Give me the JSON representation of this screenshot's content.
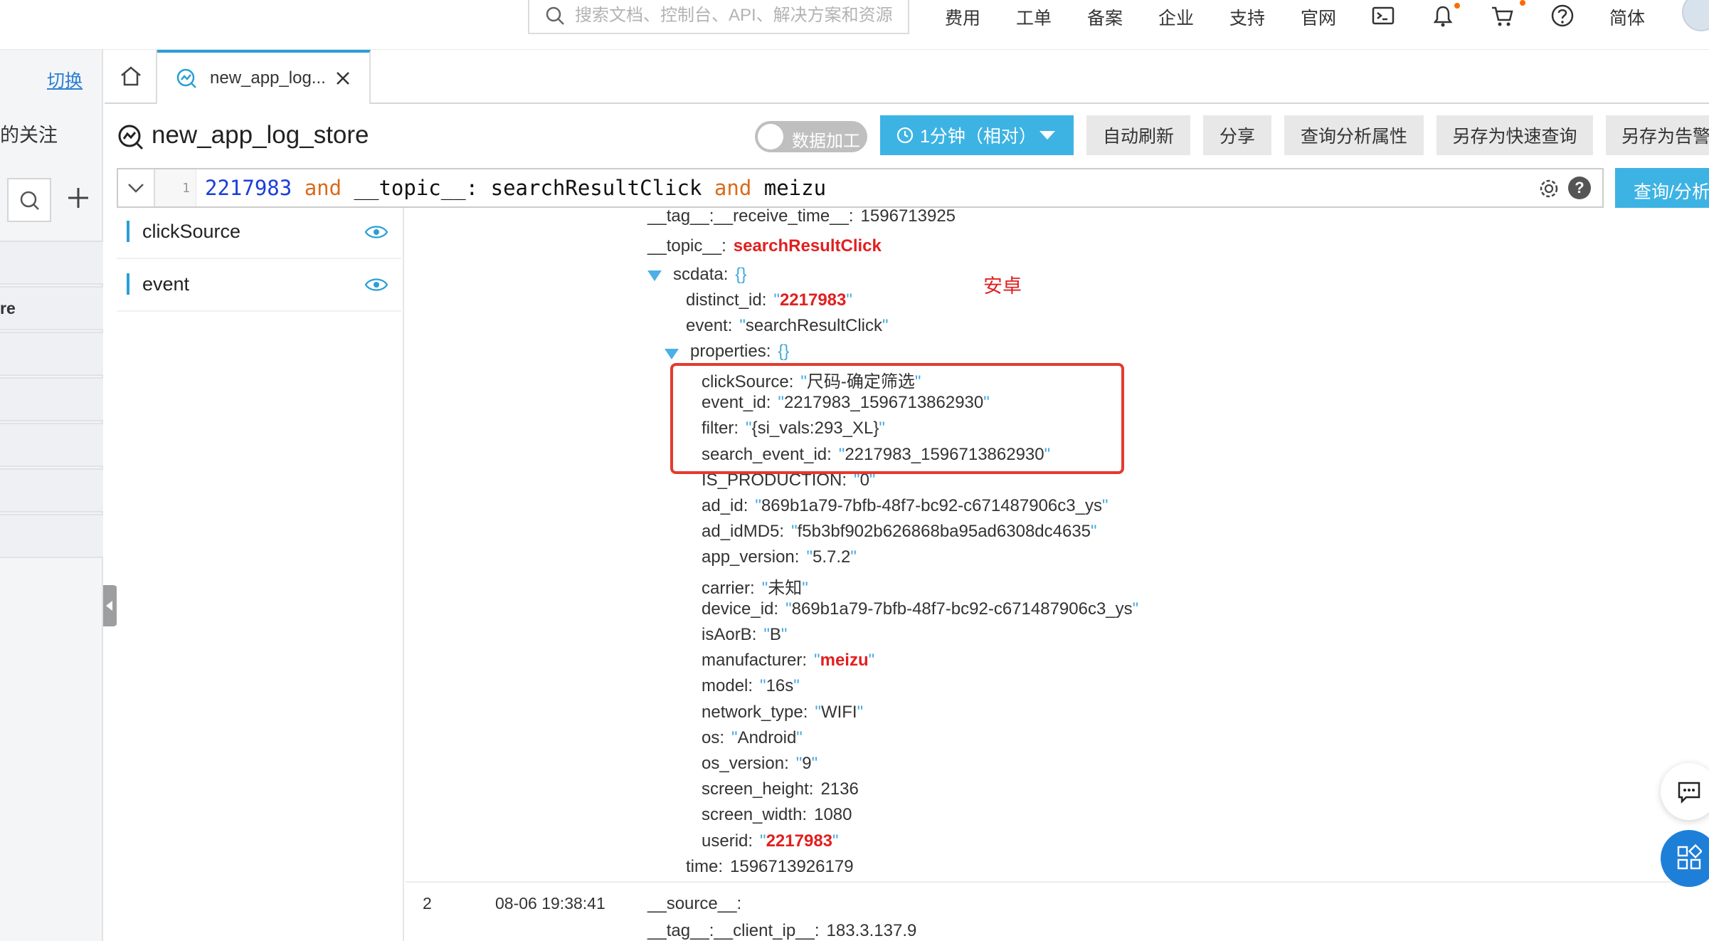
{
  "topbar": {
    "search_placeholder": "搜索文档、控制台、API、解决方案和资源",
    "nav": [
      "费用",
      "工单",
      "备案",
      "企业",
      "支持",
      "官网"
    ],
    "lang": "简体",
    "icons": [
      "terminal-icon",
      "bell-icon",
      "cart-icon",
      "help-icon"
    ],
    "accent": "#ff6a00"
  },
  "left_panel": {
    "switch_label": "切换",
    "fav_label": "的关注",
    "rows": [
      "",
      "re",
      "",
      "",
      "",
      "",
      ""
    ]
  },
  "tabs": {
    "home_icon": "home-icon",
    "active_tab": "new_app_log..."
  },
  "header": {
    "logstore_name": "new_app_log_store",
    "toggle_label": "数据加工",
    "time_range": "1分钟（相对）",
    "buttons": [
      "自动刷新",
      "分享",
      "查询分析属性",
      "另存为快速查询",
      "另存为告警"
    ],
    "accent": "#3db3e4"
  },
  "query": {
    "line_number": "1",
    "num": "2217983",
    "and1": "and",
    "field": "__topic__:",
    "value": "searchResultClick",
    "and2": "and",
    "value2": "meizu",
    "submit_label": "查询/分析"
  },
  "fields": [
    "clickSource",
    "event"
  ],
  "log": {
    "annotation": "安卓",
    "header_lines": {
      "receive_time_key": "__tag__:__receive_time__",
      "receive_time_val": "1596713925",
      "topic_key": "__topic__",
      "topic_val": "searchResultClick",
      "scdata_key": "scdata",
      "distinct_id_key": "distinct_id",
      "distinct_id_val": "2217983",
      "event_key": "event",
      "event_val": "searchResultClick",
      "properties_key": "properties"
    },
    "properties": [
      {
        "k": "clickSource",
        "v": "尺码-确定筛选",
        "red": false
      },
      {
        "k": "event_id",
        "v": "2217983_1596713862930",
        "red": false
      },
      {
        "k": "filter",
        "v": "{si_vals:293_XL}",
        "red": false
      },
      {
        "k": "search_event_id",
        "v": "2217983_1596713862930",
        "red": false
      },
      {
        "k": "IS_PRODUCTION",
        "v": "0",
        "red": false
      },
      {
        "k": "ad_id",
        "v": "869b1a79-7bfb-48f7-bc92-c671487906c3_ys",
        "red": false
      },
      {
        "k": "ad_idMD5",
        "v": "f5b3bf902b626868ba95ad6308dc4635",
        "red": false
      },
      {
        "k": "app_version",
        "v": "5.7.2",
        "red": false
      },
      {
        "k": "carrier",
        "v": "未知",
        "red": false
      },
      {
        "k": "device_id",
        "v": "869b1a79-7bfb-48f7-bc92-c671487906c3_ys",
        "red": false
      },
      {
        "k": "isAorB",
        "v": "B",
        "red": false
      },
      {
        "k": "manufacturer",
        "v": "meizu",
        "red": true
      },
      {
        "k": "model",
        "v": "16s",
        "red": false
      },
      {
        "k": "network_type",
        "v": "WIFI",
        "red": false
      },
      {
        "k": "os",
        "v": "Android",
        "red": false
      },
      {
        "k": "os_version",
        "v": "9",
        "red": false
      },
      {
        "k": "screen_height",
        "v": "2136",
        "red": false,
        "num": true
      },
      {
        "k": "screen_width",
        "v": "1080",
        "red": false,
        "num": true
      },
      {
        "k": "userid",
        "v": "2217983",
        "red": true
      }
    ],
    "time_key": "time",
    "time_val": "1596713926179",
    "row2": {
      "num": "2",
      "time": "08-06 19:38:41",
      "source_key": "__source__",
      "client_ip_key": "__tag__:__client_ip__",
      "client_ip_val": "183.3.137.9"
    }
  }
}
